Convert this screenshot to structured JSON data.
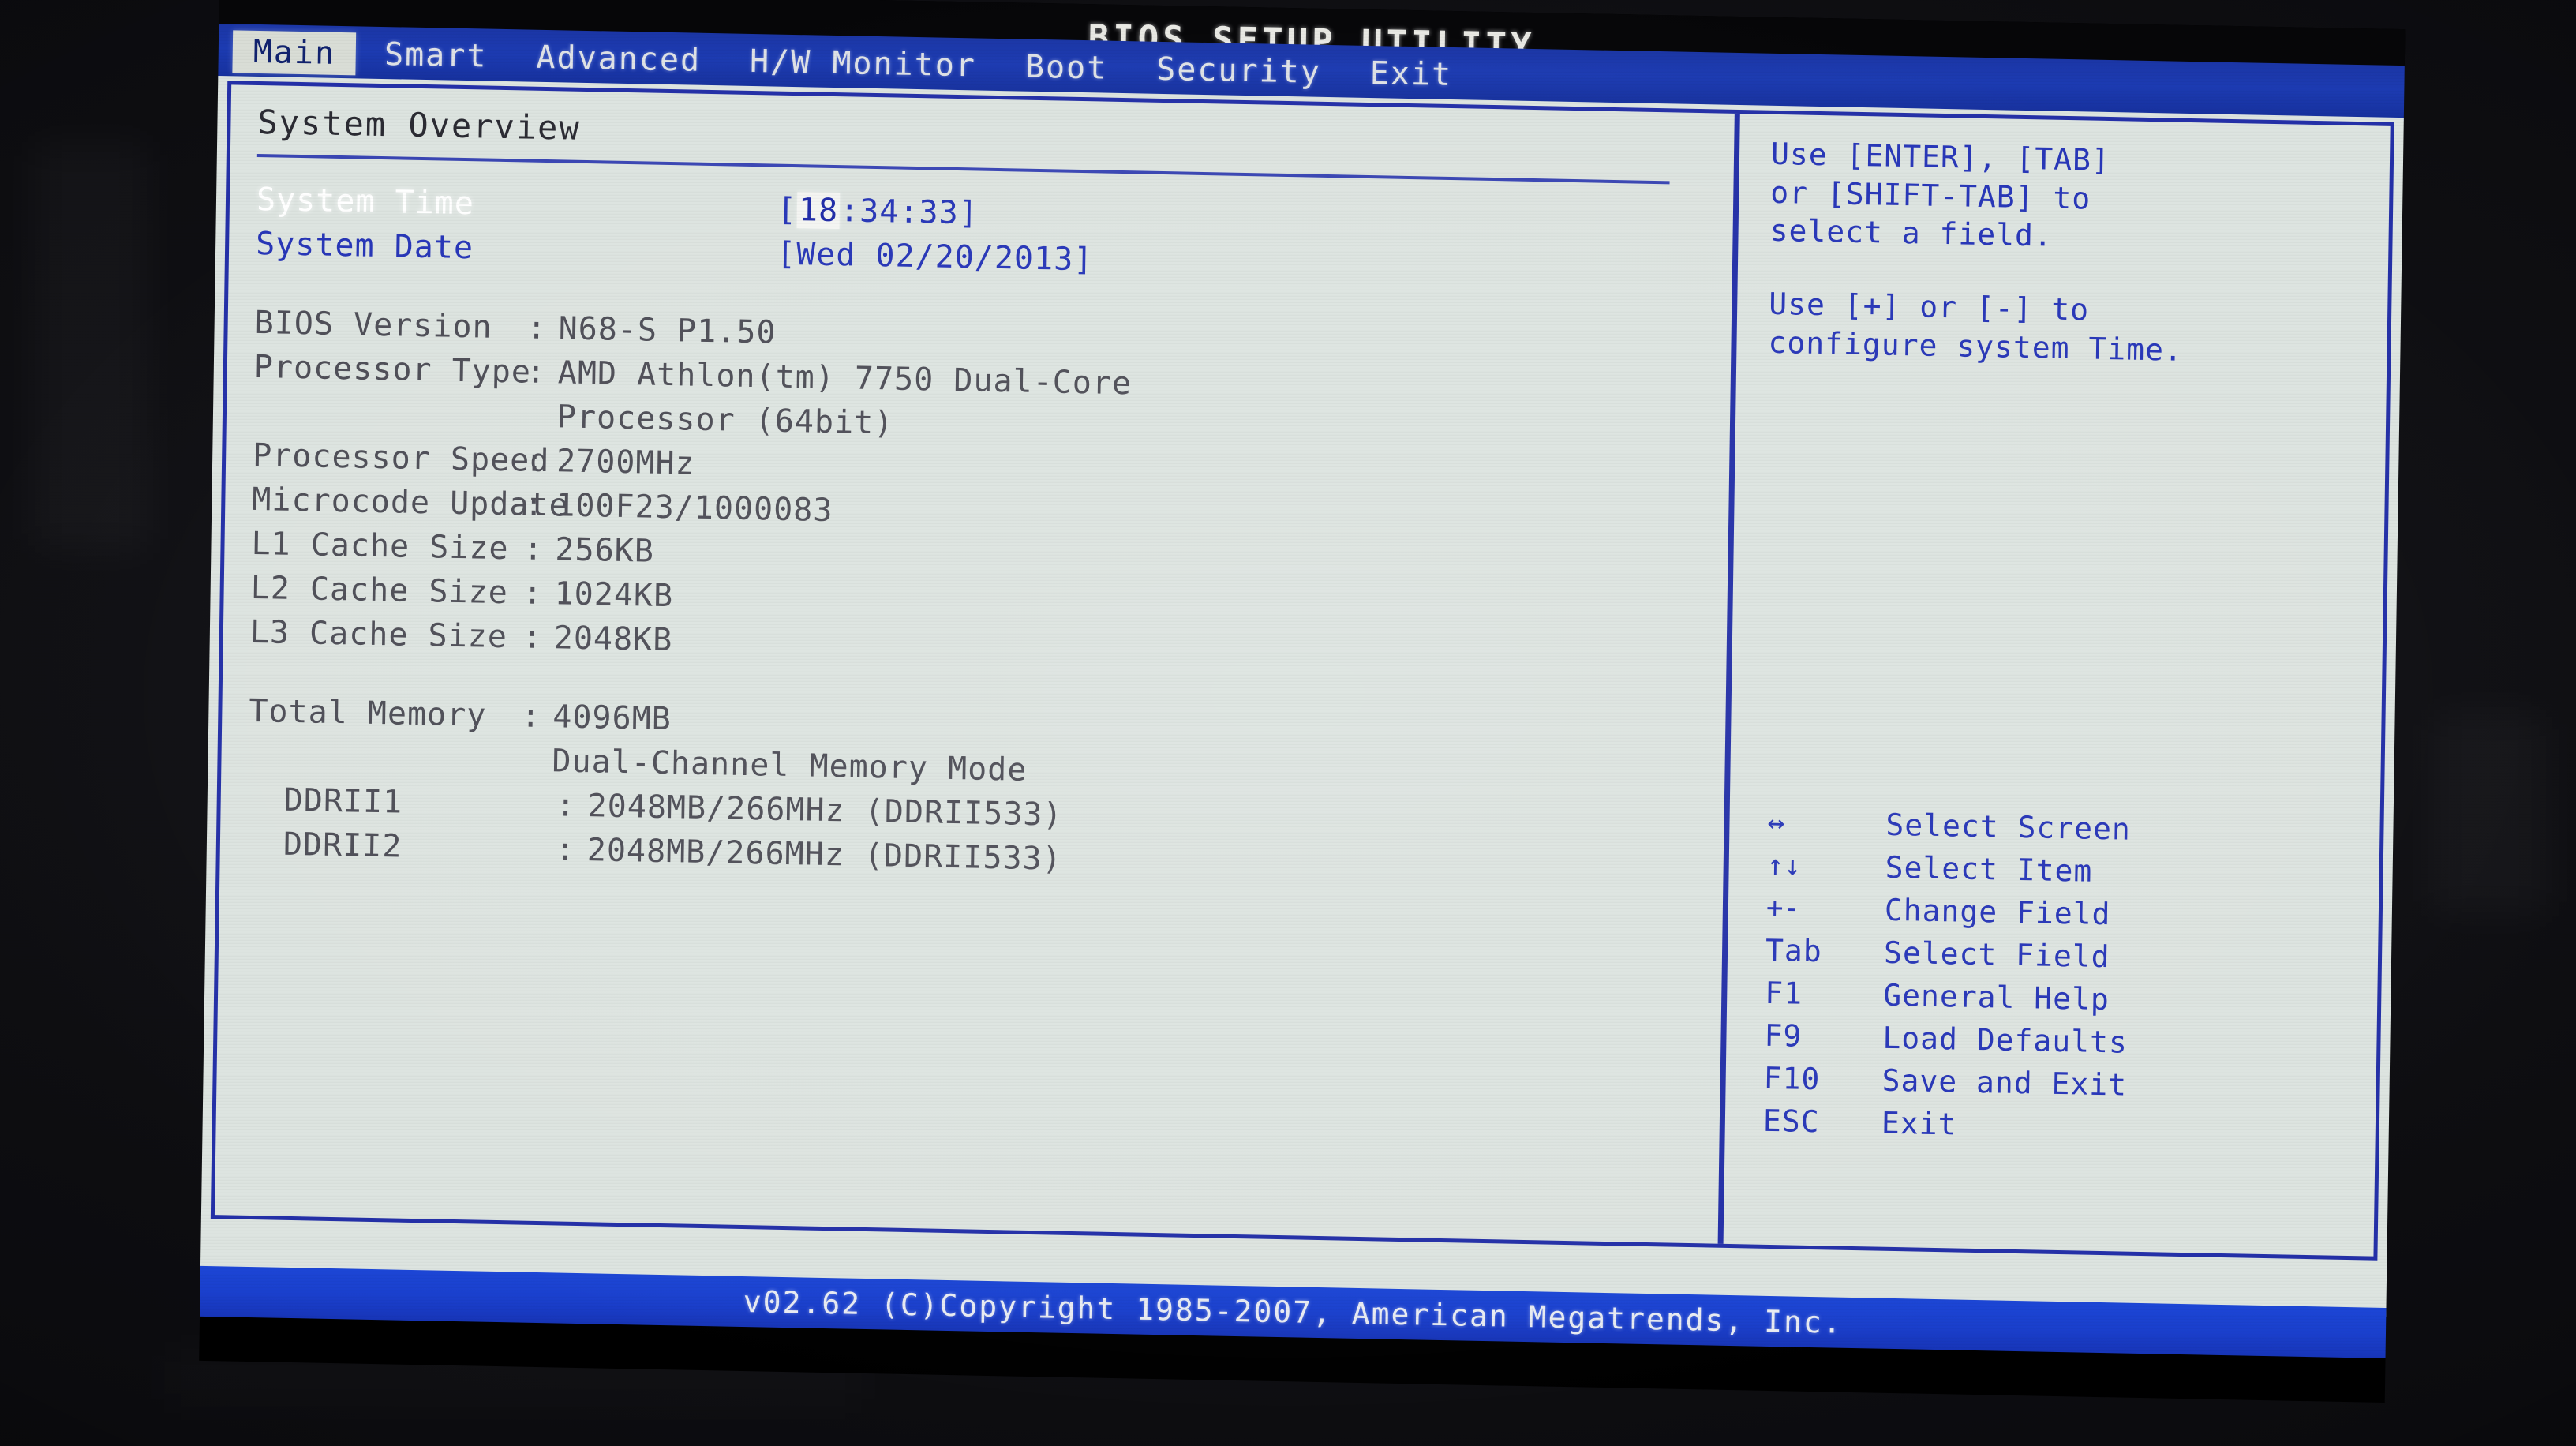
{
  "window": {
    "title": "BIOS SETUP UTILITY"
  },
  "menu": {
    "tabs": [
      {
        "label": "Main",
        "active": true
      },
      {
        "label": "Smart",
        "active": false
      },
      {
        "label": "Advanced",
        "active": false
      },
      {
        "label": "H/W Monitor",
        "active": false
      },
      {
        "label": "Boot",
        "active": false
      },
      {
        "label": "Security",
        "active": false
      },
      {
        "label": "Exit",
        "active": false
      }
    ]
  },
  "main": {
    "section_title": "System Overview",
    "time_row": {
      "label": "System Time",
      "bracket_open": "[",
      "hours": "18",
      "rest": ":34:33",
      "bracket_close": "]",
      "value": "[18:34:33]",
      "selected": true
    },
    "date_row": {
      "label": "System Date",
      "value": "[Wed 02/20/2013]"
    },
    "info": [
      {
        "label": "BIOS Version",
        "colon": ":",
        "value": "N68-S P1.50"
      },
      {
        "label": "Processor Type",
        "colon": ":",
        "value": "AMD Athlon(tm) 7750 Dual-Core"
      },
      {
        "label": "",
        "colon": "",
        "value": "Processor (64bit)"
      },
      {
        "label": "Processor Speed",
        "colon": ":",
        "value": "2700MHz"
      },
      {
        "label": "Microcode Update",
        "colon": ":",
        "value": "100F23/1000083"
      },
      {
        "label": "L1 Cache Size",
        "colon": ":",
        "value": "256KB"
      },
      {
        "label": "L2 Cache Size",
        "colon": ":",
        "value": "1024KB"
      },
      {
        "label": "L3 Cache Size",
        "colon": ":",
        "value": "2048KB"
      }
    ],
    "memory": [
      {
        "label": "Total Memory",
        "colon": ":",
        "value": "4096MB"
      },
      {
        "label": "",
        "colon": "",
        "value": "Dual-Channel Memory Mode"
      },
      {
        "label": "DDRII1",
        "colon": ":",
        "value": "2048MB/266MHz (DDRII533)"
      },
      {
        "label": "DDRII2",
        "colon": ":",
        "value": "2048MB/266MHz (DDRII533)"
      }
    ]
  },
  "help": {
    "paragraph1_line1": "Use [ENTER], [TAB]",
    "paragraph1_line2": "or [SHIFT-TAB] to",
    "paragraph1_line3": "select a field.",
    "paragraph2_line1": "Use [+] or [-] to",
    "paragraph2_line2": "configure system Time."
  },
  "keys": [
    {
      "key": "↔",
      "icon": "left-right-arrow-icon",
      "desc": "Select Screen"
    },
    {
      "key": "↑↓",
      "icon": "up-down-arrow-icon",
      "desc": "Select Item"
    },
    {
      "key": "+-",
      "icon": "plus-minus-icon",
      "desc": "Change Field"
    },
    {
      "key": "Tab",
      "icon": "tab-key-icon",
      "desc": "Select Field"
    },
    {
      "key": "F1",
      "icon": "f1-key-icon",
      "desc": "General Help"
    },
    {
      "key": "F9",
      "icon": "f9-key-icon",
      "desc": "Load Defaults"
    },
    {
      "key": "F10",
      "icon": "f10-key-icon",
      "desc": "Save and Exit"
    },
    {
      "key": "ESC",
      "icon": "esc-key-icon",
      "desc": "Exit"
    }
  ],
  "footer": {
    "text": "v02.62 (C)Copyright 1985-2007, American Megatrends, Inc."
  },
  "colors": {
    "menubar_blue": "#1c3bb2",
    "footer_blue": "#1a3fcc",
    "panel_bg": "#dde4e0",
    "frame_blue": "#2430a8",
    "text_blue": "#2736b8",
    "text_grey": "#4e4e57",
    "highlight_bg": "#f4f5f2"
  }
}
